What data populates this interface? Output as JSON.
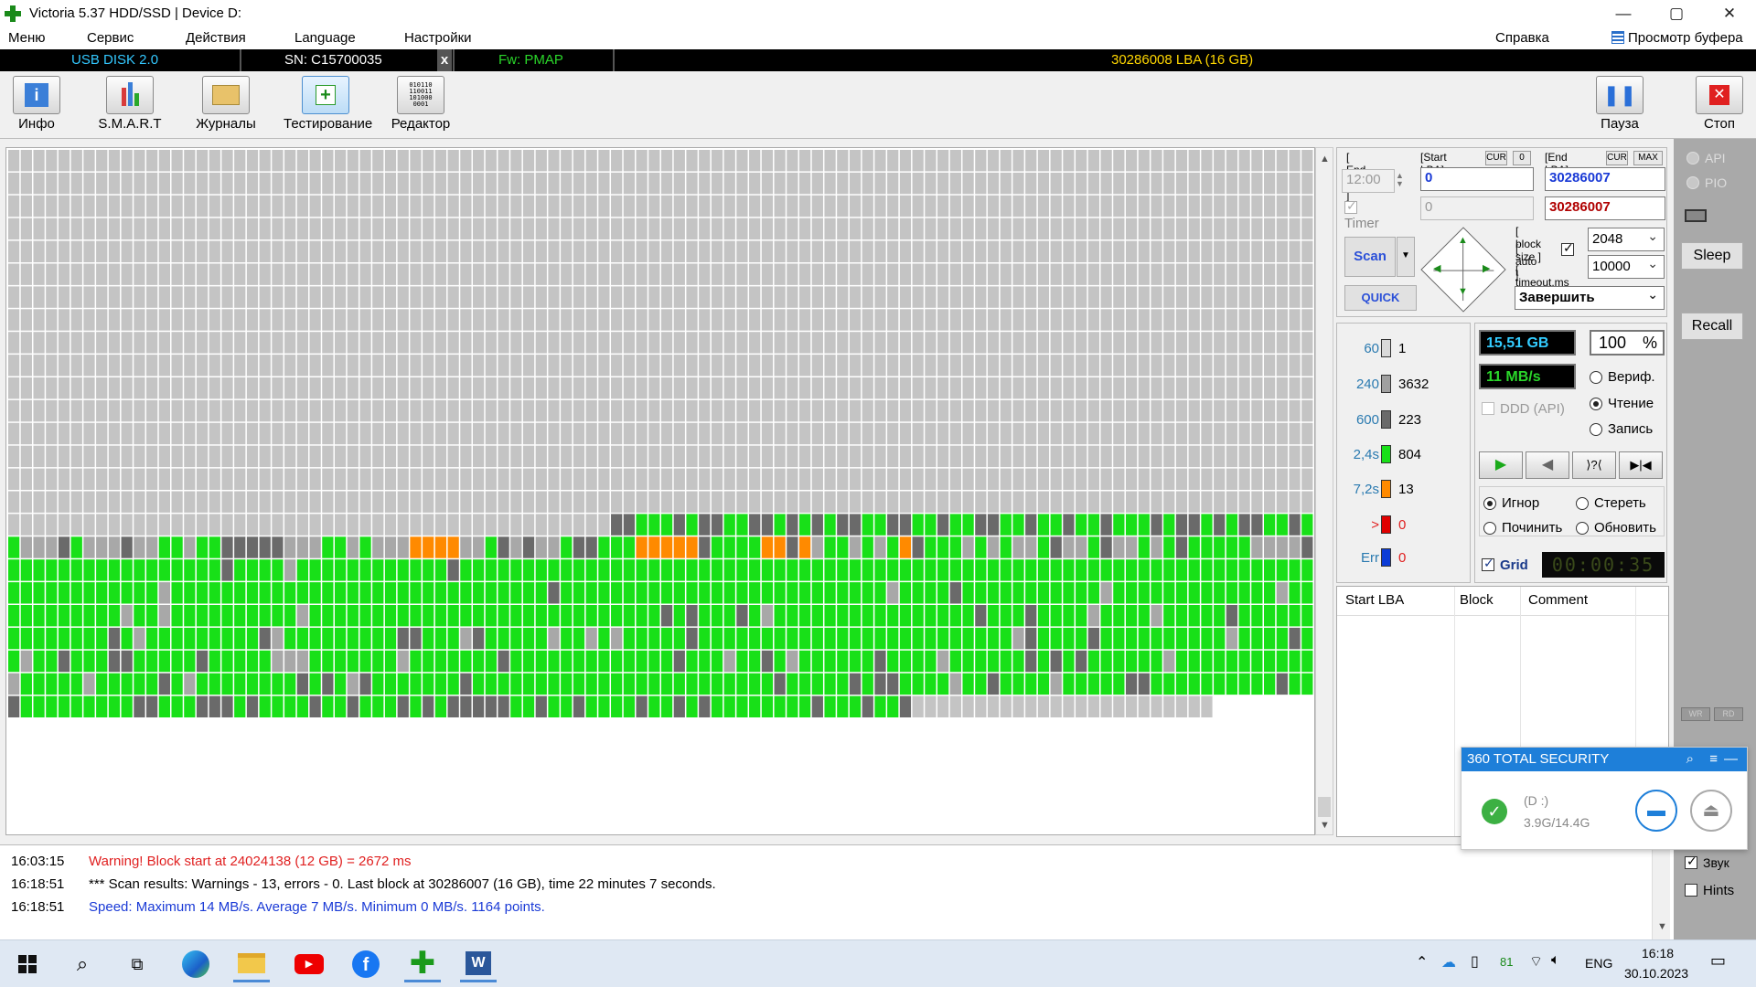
{
  "window": {
    "title": "Victoria 5.37 HDD/SSD | Device D:",
    "controls": [
      "—",
      "▢",
      "✕"
    ]
  },
  "menu": {
    "items": [
      "Меню",
      "Сервис",
      "Действия",
      "Language",
      "Настройки"
    ],
    "help": "Справка",
    "buffer": "Просмотр буфера"
  },
  "device": {
    "model": "USB DISK 2.0",
    "serial": "SN: C15700035",
    "close": "x",
    "firmware": "Fw: PMAP",
    "capacity": "30286008 LBA (16 GB)"
  },
  "toolbar": {
    "info": "Инфо",
    "smart": "S.M.A.R.T",
    "logs": "Журналы",
    "test": "Тестирование",
    "editor": "Редактор",
    "pause": "Пауза",
    "stop": "Стоп"
  },
  "scan": {
    "end_time_label": "[ End time ]",
    "end_time": "12:00",
    "timer_label": "Timer",
    "start_lba_label": "[Start LBA]",
    "cur": "CUR",
    "zero": "0",
    "start_lba": "0",
    "start_lba_2": "0",
    "end_lba_label": "[End LBA]",
    "max": "MAX",
    "end_lba": "30286007",
    "end_lba_2": "30286007",
    "block_size_label": "[ block size ]",
    "auto_label": "[ auto ]",
    "block_size": "2048",
    "timeout_label": "[ timeout,ms ]",
    "timeout": "10000",
    "scan_btn": "Scan",
    "quick_btn": "QUICK",
    "finish_option": "Завершить"
  },
  "stats": {
    "scanned": "15,51 GB",
    "percent": "100",
    "percent_sign": "%",
    "speed": "11 MB/s",
    "ddd": "DDD (API)",
    "modes": [
      "Вериф.",
      "Чтение",
      "Запись"
    ],
    "actions": [
      "Игнор",
      "Стереть",
      "Починить",
      "Обновить"
    ],
    "grid_label": "Grid",
    "elapsed": "00:00:35"
  },
  "legend": [
    {
      "label": "60",
      "count": "1",
      "color": "#d9d9d9"
    },
    {
      "label": "240",
      "count": "3632",
      "color": "#a0a0a0"
    },
    {
      "label": "600",
      "count": "223",
      "color": "#6a6a6a"
    },
    {
      "label": "2,4s",
      "count": "804",
      "color": "#18e018"
    },
    {
      "label": "7,2s",
      "count": "13",
      "color": "#ff8a00"
    },
    {
      "label": ">",
      "count": "0",
      "color": "#e00000"
    },
    {
      "label": "Err",
      "count": "0",
      "color": "#0b3bd6"
    }
  ],
  "table": {
    "headers": [
      "Start LBA",
      "Block",
      "Comment"
    ]
  },
  "side": {
    "api": "API",
    "pio": "PIO",
    "sleep": "Sleep",
    "recall": "Recall",
    "wr": "WR",
    "rd": "RD",
    "sound": "Звук",
    "hints": "Hints"
  },
  "log": [
    {
      "time": "16:03:15",
      "text": "Warning! Block start at 24024138 (12 GB)  = 2672 ms",
      "color": "#e02020"
    },
    {
      "time": "16:18:51",
      "text": "*** Scan results: Warnings - 13, errors - 0. Last block at 30286007 (16 GB), time 22 minutes 7 seconds.",
      "color": "#000000"
    },
    {
      "time": "16:18:51",
      "text": "Speed: Maximum 14 MB/s. Average 7 MB/s. Minimum 0 MB/s. 1164 points.",
      "color": "#1a3ad6"
    }
  ],
  "popup": {
    "title": "360 TOTAL SECURITY",
    "drive": "(D :)",
    "usage": "3.9G/14.4G"
  },
  "taskbar": {
    "battery": "81",
    "lang": "ENG",
    "time": "16:18",
    "date": "30.10.2023"
  }
}
